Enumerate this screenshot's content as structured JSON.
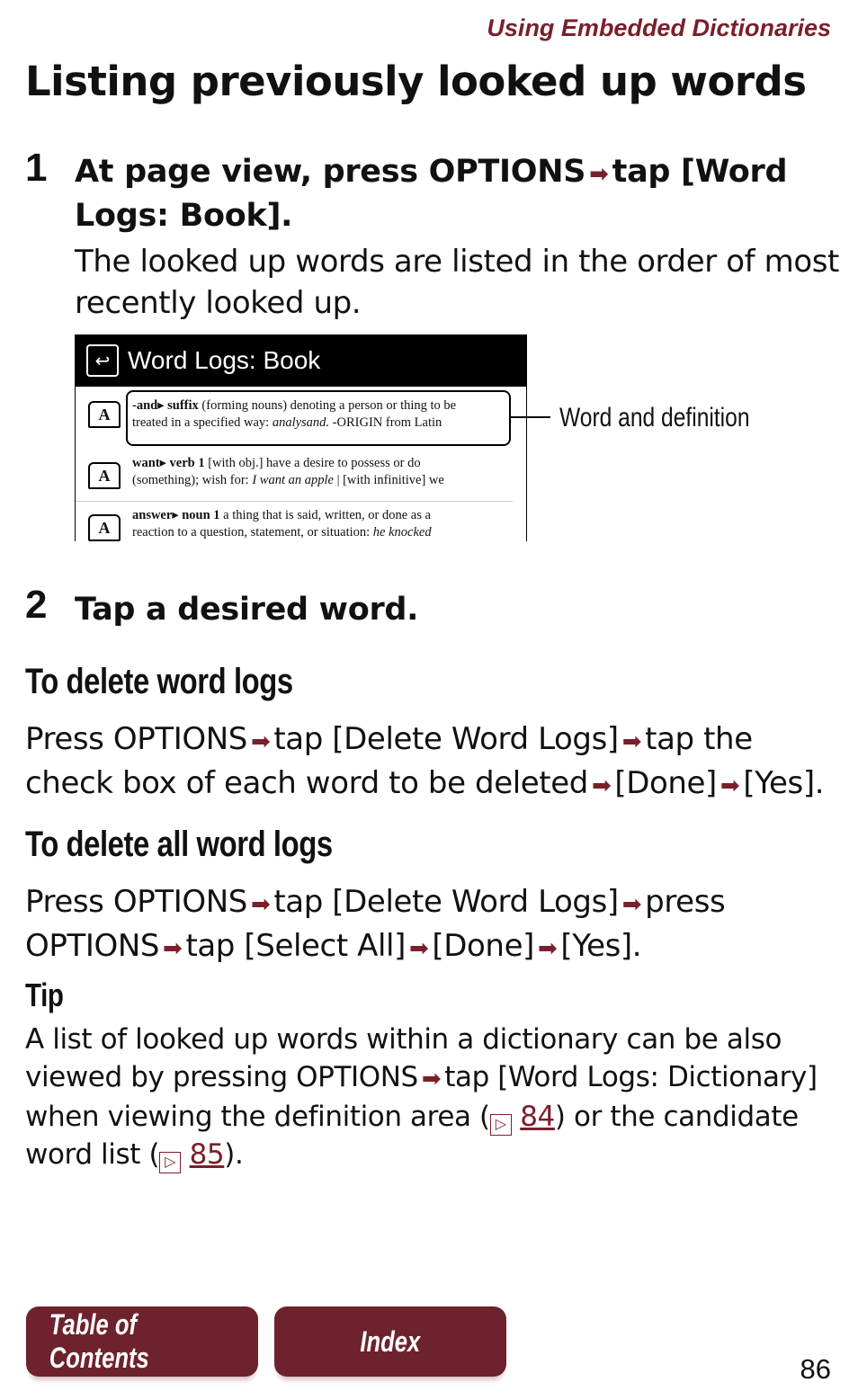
{
  "header": {
    "section": "Using Embedded Dictionaries"
  },
  "title": "Listing previously looked up words",
  "steps": [
    {
      "num": "1",
      "head": [
        "At page view, press OPTIONS",
        "tap [Word",
        "Logs: Book]."
      ],
      "desc": "The looked up words are listed in the order of most recently looked up."
    },
    {
      "num": "2",
      "head": "Tap a desired word."
    }
  ],
  "screenshot": {
    "title": "Word Logs: Book",
    "entries": [
      {
        "icon": "A",
        "word": "-and",
        "pos": "suffix",
        "l1": "(forming nouns) denoting a person or thing to be",
        "l2a": "treated in a specified way: ",
        "l2i": "analysand.",
        "l2b": "  -ORIGIN from Latin"
      },
      {
        "icon": "A",
        "word": "want",
        "pos": "verb 1",
        "l1": "[with obj.] have a desire to possess or do",
        "l2a": "(something); wish for: ",
        "l2i": "I want an apple",
        "l2b": "  |  [with infinitive] we"
      },
      {
        "icon": "A",
        "word": "answer",
        "pos": "noun 1",
        "l1": "a thing that is said, written, or done as a",
        "l2a": "reaction to a question, statement, or situation: ",
        "l2i": "he knocked",
        "l2b": ""
      }
    ],
    "callout": "Word and definition"
  },
  "delete": {
    "heading": "To delete word logs",
    "parts": [
      "Press OPTIONS",
      "tap [Delete Word Logs]",
      "tap the check box of each word to be deleted",
      "[Done]",
      "[Yes]."
    ]
  },
  "delete_all": {
    "heading": "To delete all word logs",
    "parts": [
      "Press OPTIONS",
      "tap [Delete Word Logs]",
      "press OPTIONS",
      "tap [Select All]",
      "[Done]",
      "[Yes]."
    ]
  },
  "tip": {
    "heading": "Tip",
    "p1": "A list of looked up words within a dictionary can be also viewed by pressing OPTIONS",
    "p2": "tap [Word Logs: Dictionary] when viewing the definition area (",
    "ref1": "84",
    "p3": ") or the candidate word list (",
    "ref2": "85",
    "p4": ")."
  },
  "nav": {
    "toc": "Table of Contents",
    "index": "Index"
  },
  "page_number": "86",
  "colors": {
    "accent": "#7a1f2b",
    "button": "#6e222d"
  }
}
